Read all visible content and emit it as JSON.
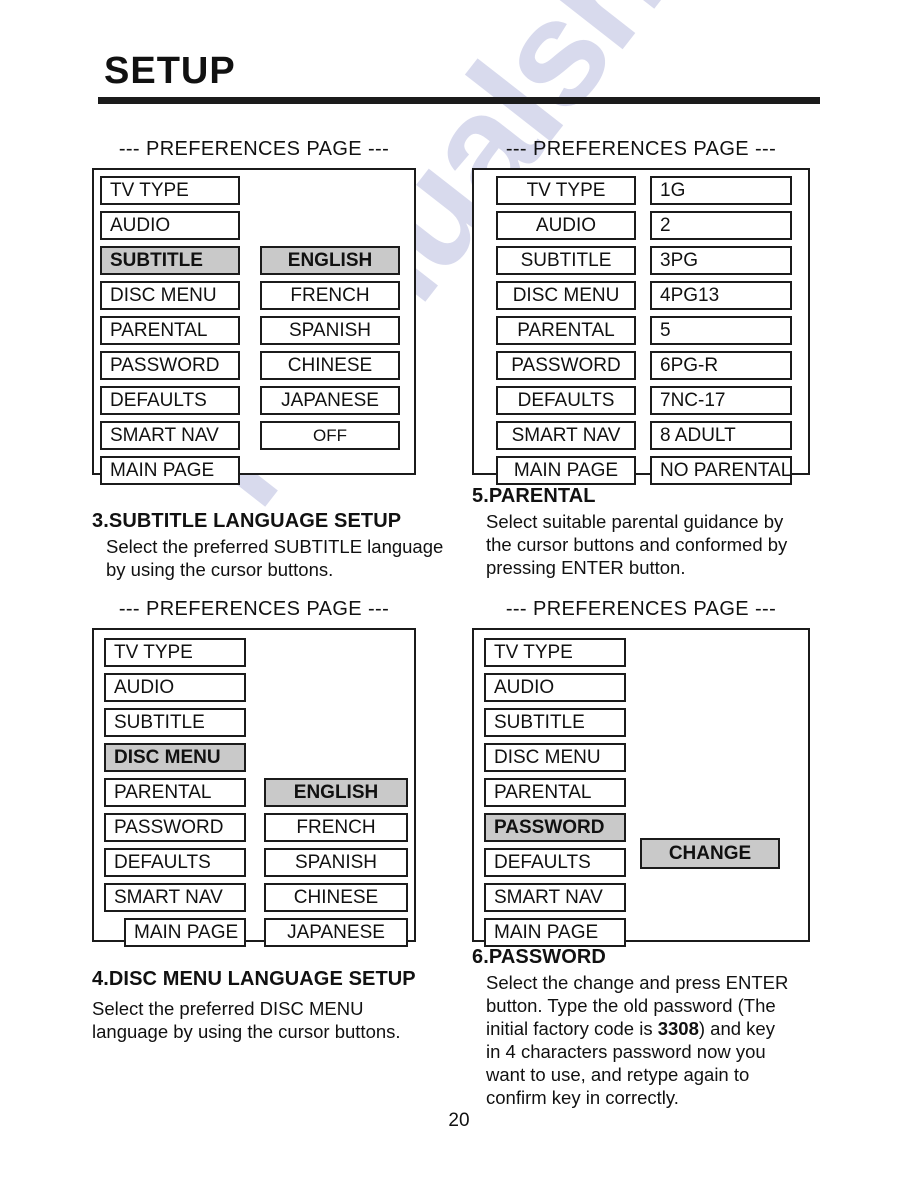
{
  "page": {
    "title": "SETUP",
    "number": "20",
    "watermark": "manualshi.com"
  },
  "panels": [
    {
      "id": "subtitle",
      "caption": "--- PREFERENCES PAGE ---",
      "left_items": [
        {
          "label": "TV TYPE",
          "selected": false
        },
        {
          "label": "AUDIO",
          "selected": false
        },
        {
          "label": "SUBTITLE",
          "selected": true
        },
        {
          "label": "DISC MENU",
          "selected": false
        },
        {
          "label": "PARENTAL",
          "selected": false
        },
        {
          "label": "PASSWORD",
          "selected": false
        },
        {
          "label": "DEFAULTS",
          "selected": false
        },
        {
          "label": "SMART NAV",
          "selected": false
        },
        {
          "label": "MAIN PAGE",
          "selected": false
        }
      ],
      "right_items": [
        {
          "label": "ENGLISH",
          "selected": true
        },
        {
          "label": "FRENCH",
          "selected": false
        },
        {
          "label": "SPANISH",
          "selected": false
        },
        {
          "label": "CHINESE",
          "selected": false
        },
        {
          "label": "JAPANESE",
          "selected": false
        },
        {
          "label": "OFF",
          "selected": false
        }
      ]
    },
    {
      "id": "parental",
      "caption": "--- PREFERENCES PAGE ---",
      "left_items": [
        {
          "label": "TV TYPE",
          "selected": false
        },
        {
          "label": "AUDIO",
          "selected": false
        },
        {
          "label": "SUBTITLE",
          "selected": false
        },
        {
          "label": "DISC MENU",
          "selected": false
        },
        {
          "label": "PARENTAL",
          "selected": false
        },
        {
          "label": "PASSWORD",
          "selected": false
        },
        {
          "label": "DEFAULTS",
          "selected": false
        },
        {
          "label": "SMART NAV",
          "selected": false
        },
        {
          "label": "MAIN PAGE",
          "selected": false
        }
      ],
      "right_items": [
        {
          "label": "1G",
          "selected": false
        },
        {
          "label": "2",
          "selected": false
        },
        {
          "label": "3PG",
          "selected": false
        },
        {
          "label": "4PG13",
          "selected": false
        },
        {
          "label": "5",
          "selected": false
        },
        {
          "label": "6PG-R",
          "selected": false
        },
        {
          "label": "7NC-17",
          "selected": false
        },
        {
          "label": "8 ADULT",
          "selected": false
        },
        {
          "label": "NO PARENTAL",
          "selected": false
        }
      ]
    },
    {
      "id": "disc-menu",
      "caption": "--- PREFERENCES PAGE ---",
      "left_items": [
        {
          "label": "TV  TYPE",
          "selected": false
        },
        {
          "label": "AUDIO",
          "selected": false
        },
        {
          "label": "SUBTITLE",
          "selected": false
        },
        {
          "label": "DISC MENU",
          "selected": true
        },
        {
          "label": "PARENTAL",
          "selected": false
        },
        {
          "label": "PASSWORD",
          "selected": false
        },
        {
          "label": "DEFAULTS",
          "selected": false
        },
        {
          "label": "SMART NAV",
          "selected": false
        },
        {
          "label": "MAIN PAGE",
          "selected": false
        }
      ],
      "right_items": [
        {
          "label": "ENGLISH",
          "selected": true
        },
        {
          "label": "FRENCH",
          "selected": false
        },
        {
          "label": "SPANISH",
          "selected": false
        },
        {
          "label": "CHINESE",
          "selected": false
        },
        {
          "label": "JAPANESE",
          "selected": false
        }
      ]
    },
    {
      "id": "password",
      "caption": "--- PREFERENCES PAGE ---",
      "left_items": [
        {
          "label": "TV  TYPE",
          "selected": false
        },
        {
          "label": "AUDIO",
          "selected": false
        },
        {
          "label": "SUBTITLE",
          "selected": false
        },
        {
          "label": "DISC MENU",
          "selected": false
        },
        {
          "label": "PARENTAL",
          "selected": false
        },
        {
          "label": "PASSWORD",
          "selected": true
        },
        {
          "label": "DEFAULTS",
          "selected": false
        },
        {
          "label": "SMART NAV",
          "selected": false
        },
        {
          "label": "MAIN PAGE",
          "selected": false
        }
      ],
      "right_items": [
        {
          "label": "CHANGE",
          "selected": true
        }
      ]
    }
  ],
  "notes": [
    {
      "id": "subtitle-note",
      "heading": "3.SUBTITLE LANGUAGE SETUP",
      "lines": [
        "Select the preferred SUBTITLE language",
        " by using the cursor buttons."
      ]
    },
    {
      "id": "parental-note",
      "heading": "5.PARENTAL",
      "lines": [
        "Select suitable parental guidance by",
        "the cursor buttons and conformed by",
        "pressing ENTER button."
      ]
    },
    {
      "id": "disc-menu-note",
      "heading": "4.DISC MENU LANGUAGE SETUP",
      "lines": [
        "Select the preferred DISC MENU",
        "language by using the cursor buttons."
      ]
    },
    {
      "id": "password-note",
      "heading": "6.PASSWORD",
      "lines_rich": [
        [
          {
            "t": "Select the change and press ENTER"
          }
        ],
        [
          {
            "t": "button.  Type the old password (The"
          }
        ],
        [
          {
            "t": "initial factory code is "
          },
          {
            "t": "3308",
            "b": true
          },
          {
            "t": ") and key"
          }
        ],
        [
          {
            "t": "in 4 characters password now you"
          }
        ],
        [
          {
            "t": "want to use, and retype again to"
          }
        ],
        [
          {
            "t": "confirm key in correctly."
          }
        ]
      ]
    }
  ]
}
